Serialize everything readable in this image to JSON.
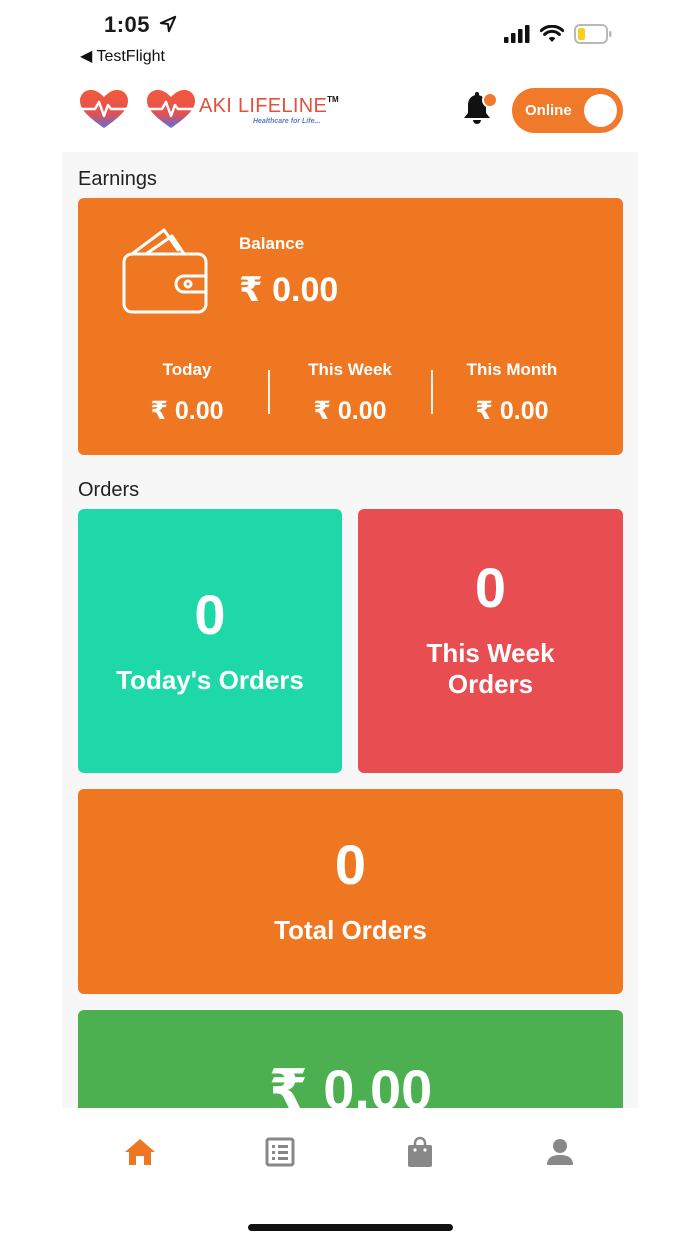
{
  "status_bar": {
    "time": "1:05",
    "back_app": "◀ TestFlight"
  },
  "header": {
    "brand_name": "AKI LIFELINE",
    "brand_tm": "TM",
    "brand_tagline": "Healthcare for Life...",
    "online_toggle": {
      "label": "Online",
      "state": "on"
    },
    "notification_badge": true
  },
  "earnings": {
    "section_title": "Earnings",
    "balance_label": "Balance",
    "balance_value": "₹ 0.00",
    "today_label": "Today",
    "today_value": "₹ 0.00",
    "week_label": "This Week",
    "week_value": "₹ 0.00",
    "month_label": "This Month",
    "month_value": "₹ 0.00"
  },
  "orders": {
    "section_title": "Orders",
    "today": {
      "count": "0",
      "label": "Today's Orders"
    },
    "week": {
      "count": "0",
      "label_line1": "This Week",
      "label_line2": "Orders"
    },
    "total": {
      "count": "0",
      "label": "Total Orders"
    },
    "amount": {
      "value": "₹ 0.00"
    }
  },
  "bottom_nav": {
    "items": [
      "home",
      "orders-list",
      "shop",
      "profile"
    ],
    "active": "home"
  },
  "colors": {
    "accent": "#f07722",
    "teal": "#1fd8a8",
    "red": "#e84d52",
    "green": "#4caf50"
  }
}
